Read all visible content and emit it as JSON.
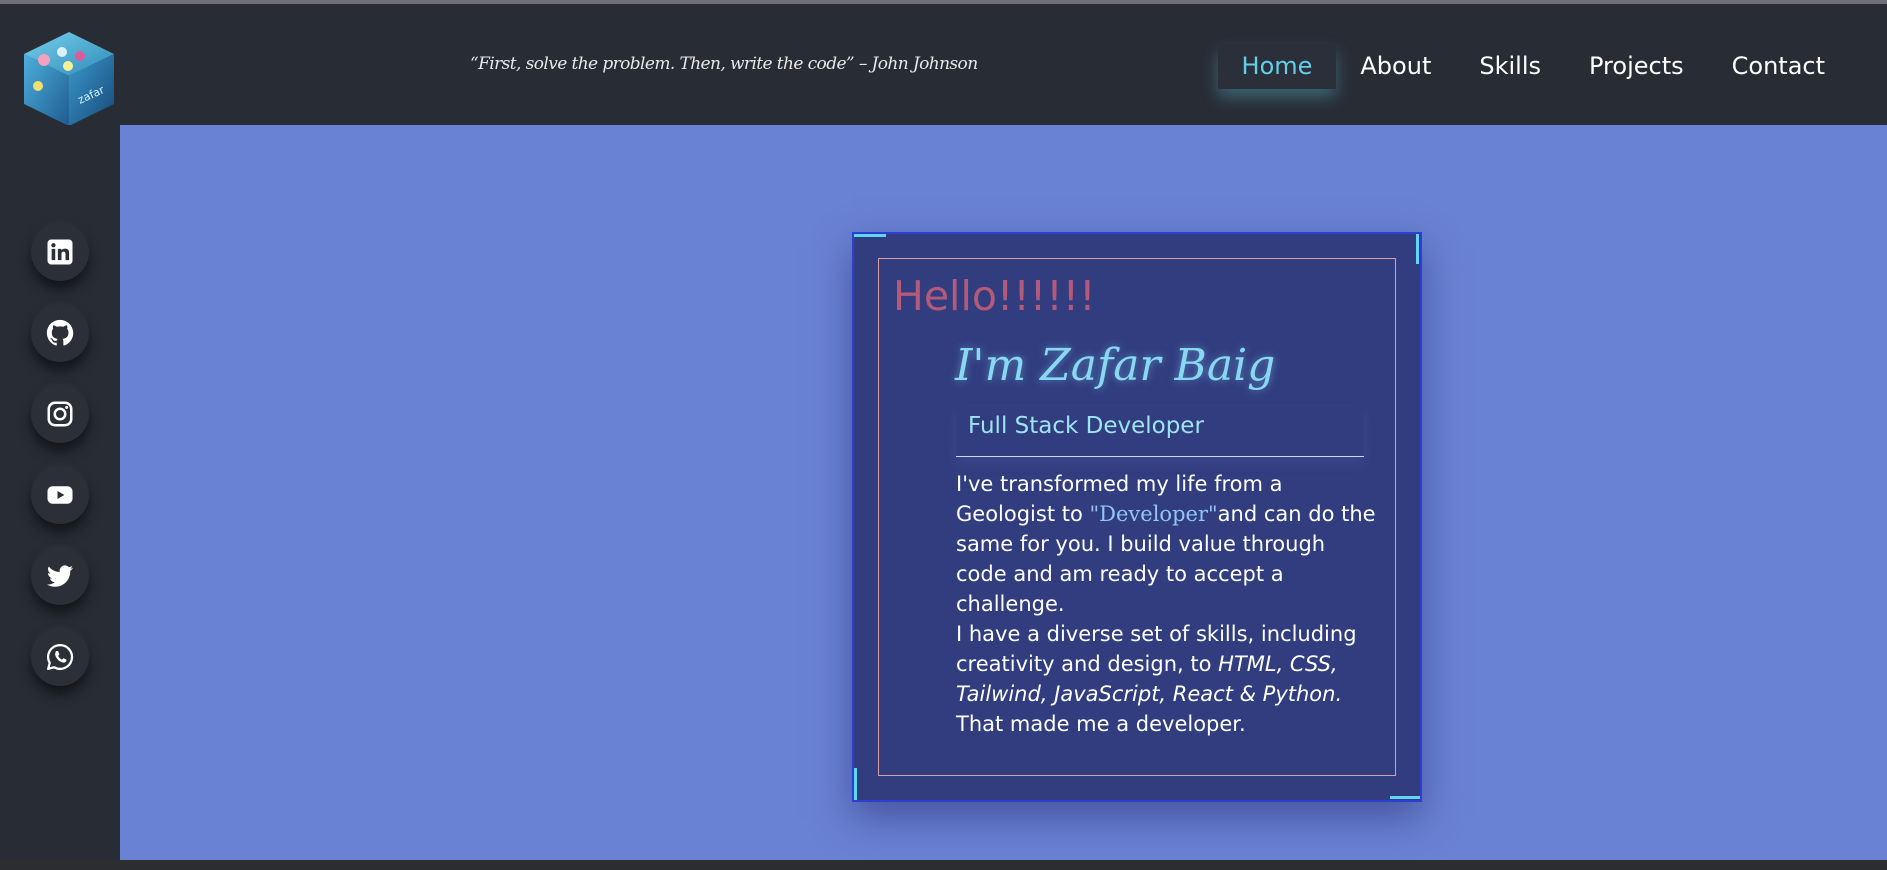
{
  "header": {
    "quote": "“First, solve the problem. Then, write the code” – John Johnson",
    "nav": [
      {
        "label": "Home",
        "active": true
      },
      {
        "label": "About",
        "active": false
      },
      {
        "label": "Skills",
        "active": false
      },
      {
        "label": "Projects",
        "active": false
      },
      {
        "label": "Contact",
        "active": false
      }
    ],
    "logo_text": "zafar"
  },
  "sidebar": {
    "socials": [
      {
        "icon": "linkedin-icon"
      },
      {
        "icon": "github-icon"
      },
      {
        "icon": "instagram-icon"
      },
      {
        "icon": "youtube-icon"
      },
      {
        "icon": "twitter-icon"
      },
      {
        "icon": "whatsapp-icon"
      }
    ]
  },
  "hero": {
    "hello": "Hello!!!!!!",
    "name": "I'm Zafar Baig",
    "role": "Full Stack Developer",
    "bio_1_a": "I've transformed my life from a Geologist to ",
    "bio_1_highlight": "\"Developer\"",
    "bio_1_b": "and can do the same for you. I build value through code and am ready to accept a challenge.",
    "bio_2_a": "I have a diverse set of skills, including creativity and design, to ",
    "bio_2_skills": "HTML, CSS, Tailwind, JavaScript, React & Python.",
    "bio_2_b": " That made me a developer."
  },
  "colors": {
    "main_bg": "#6a82d3",
    "dark_bg": "#282c35",
    "card_bg": "#313d7f",
    "accent": "#62cfe8",
    "hello": "#b35a7a"
  }
}
